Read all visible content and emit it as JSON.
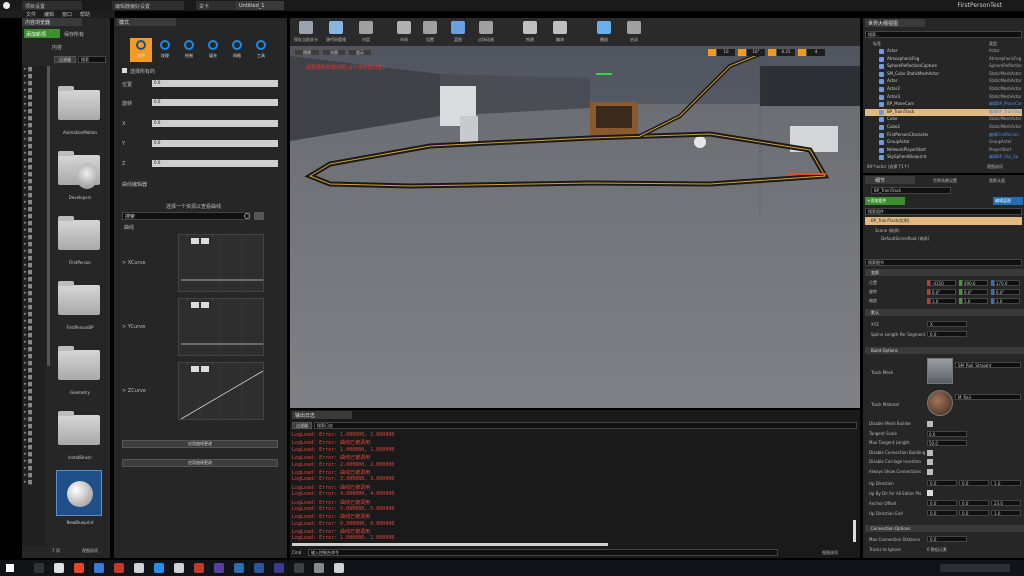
{
  "window": {
    "title": "FirstPersonTest",
    "tabs": [
      "项目设置",
      "编辑器偏好设置",
      "关卡",
      "Untitled_1"
    ],
    "menu": [
      "文件",
      "编辑",
      "窗口",
      "帮助"
    ]
  },
  "content_browser": {
    "tab": "内容浏览器",
    "add_button": "添加新项",
    "import_button": "导入",
    "save_button": "保存所有",
    "nav": [
      "内容"
    ],
    "filter_button": "过滤器",
    "search_placeholder": "搜索",
    "items": [
      {
        "label": "AnimationMotion",
        "type": "folder"
      },
      {
        "label": "Developers",
        "type": "folder-dev"
      },
      {
        "label": "FirstPerson",
        "type": "folder"
      },
      {
        "label": "FirstPersonBP",
        "type": "folder"
      },
      {
        "label": "Geometry",
        "type": "folder"
      },
      {
        "label": "InstallBrush",
        "type": "folder"
      },
      {
        "label": "NewBlueprint",
        "type": "sphere"
      }
    ],
    "footer_count": "7 项",
    "footer_view": "视图选项"
  },
  "modes": {
    "tab": "模式",
    "tools": [
      "选择",
      "纹理",
      "绘制",
      "填充",
      "网格",
      "工具"
    ],
    "section_title": "选择模式",
    "label_a": "选择所有的",
    "fields": [
      {
        "label": "位置",
        "value": "0.0"
      },
      {
        "label": "旋转",
        "value": "0.0"
      },
      {
        "label": "X",
        "value": "0.0"
      },
      {
        "label": "Y",
        "value": "0.0"
      },
      {
        "label": "Z",
        "value": "0.0"
      }
    ],
    "curve_title": "曲线编辑器",
    "hint": "选择一个资源以查看曲线",
    "search_placeholder": "搜索",
    "tree_label": "曲线",
    "curves": [
      {
        "label": "XCurve",
        "type": "flat"
      },
      {
        "label": "YCurve",
        "type": "flat"
      },
      {
        "label": "ZCurve",
        "type": "linear"
      }
    ],
    "button_a": "应用曲线更改",
    "button_b": "应用曲线更改"
  },
  "toolbar": {
    "buttons": [
      "保存当前关卡",
      "源代码管理",
      "内容",
      "市场",
      "设置",
      "蓝图",
      "过场动画",
      "构建",
      "编译",
      "播放",
      "启动"
    ]
  },
  "viewport": {
    "mode_a": "透视",
    "mode_b": "光照",
    "mode_c": "显示",
    "warning": "需要重新构建光照 (1个未构建对象)",
    "snap_values": [
      "10",
      "10°",
      "0.25",
      "4"
    ]
  },
  "output_log": {
    "tab": "输出日志",
    "filter": "过滤器",
    "search_placeholder": "搜索日志",
    "lines": [
      "LogLoad: Error: 1.000000, 1.000000",
      "LogLoad: Error: 曲线已被调用",
      "LogLoad: Error: 1.000000, 1.000000",
      "LogLoad: Error: 曲线已被调用",
      "LogLoad: Error: 2.000000, 2.000000",
      "LogLoad: Error: 曲线已被调用",
      "LogLoad: Error: 3.000000, 3.000000",
      "LogLoad: Error: 曲线已被调用",
      "LogLoad: Error: 4.000000, 4.000000",
      "LogLoad: Error: 曲线已被调用",
      "LogLoad: Error: 5.000000, 5.000000",
      "LogLoad: Error: 曲线已被调用",
      "LogLoad: Error: 0.000000, 0.000000",
      "LogLoad: Error: 曲线已被调用",
      "LogLoad: Error: 1.000000, 1.000000",
      "LogLoad: Error: 曲线已被调用",
      "LogLoad: Error: 2.000000, 2.000000",
      "LogLoad: Error: 曲线已被调用"
    ],
    "cmd_label": "Cmd",
    "cmd_placeholder": "输入控制台命令",
    "view_options": "视图选项"
  },
  "outliner": {
    "tab": "世界大纲视图",
    "search_placeholder": "搜索...",
    "col_label": "标签",
    "col_type": "类型",
    "rows": [
      {
        "label": "Actor",
        "type": "Actor"
      },
      {
        "label": "AtmosphericFog",
        "type": "AtmosphericFog"
      },
      {
        "label": "SphereReflectionCapture",
        "type": "SphereReflectionCapture"
      },
      {
        "label": "SM_Cube StaticMeshActor",
        "type": "StaticMeshActor"
      },
      {
        "label": "Actor",
        "type": "StaticMeshActor"
      },
      {
        "label": "Actor2",
        "type": "StaticMeshActor"
      },
      {
        "label": "Actor3",
        "type": "StaticMeshActor"
      },
      {
        "label": "BP_MoveCam",
        "type": "编辑BP_MoveCam"
      },
      {
        "label": "BP_TrainTrack",
        "type": "编辑BP_TrainTrack",
        "selected": true
      },
      {
        "label": "Cube",
        "type": "StaticMeshActor"
      },
      {
        "label": "Cube2",
        "type": "StaticMeshActor"
      },
      {
        "label": "FirstPersonCharacter",
        "type": "编辑FirstPerson"
      },
      {
        "label": "GroupActor",
        "type": "GroupActor"
      },
      {
        "label": "NetworkPlayerStart",
        "type": "PlayerStart"
      },
      {
        "label": "SkySphereBlueprint",
        "type": "编辑BP_Sky_Sp"
      }
    ],
    "footer": "69个actor (选择了1个)",
    "view_options": "视图选项"
  },
  "details": {
    "tabs": [
      "细节",
      "世界场景设置",
      "类默认值"
    ],
    "name": "BP_TrainTrack",
    "add_component": "+添加组件",
    "blueprint_button": "编辑蓝图",
    "search_placeholder": "搜索组件",
    "component_root": "BP_TrainTrack(实例)",
    "components": [
      "Scene (继承)",
      "DefaultSceneRoot (继承)"
    ],
    "search2_placeholder": "搜索细节",
    "transform_header": "变换",
    "transform": [
      {
        "label": "位置",
        "x": "-4150",
        "y": "490.0",
        "z": "170.0"
      },
      {
        "label": "旋转",
        "x": "0.0°",
        "y": "0.0°",
        "z": "0.0°"
      },
      {
        "label": "缩放",
        "x": "1.0",
        "y": "1.0",
        "z": "1.0"
      }
    ],
    "default_header": "默认",
    "xyz_label": "XYZ",
    "xyz_value": "X",
    "spline_label": "Spline Length Per Segment",
    "spline_value": "0.0",
    "build_header": "Build Options",
    "track_mesh_label": "Track Mesh",
    "track_mesh_value": "SM_Rail_Straight",
    "track_material_label": "Track Material",
    "track_material_value": "M_Rail",
    "options": [
      {
        "label": "Disable Mesh Builder",
        "kind": "check"
      },
      {
        "label": "Tangent Scale",
        "kind": "num",
        "value": "0.0"
      },
      {
        "label": "Max Tangent Length",
        "kind": "num",
        "value": "50.0"
      },
      {
        "label": "Disable Connection Building",
        "kind": "check"
      },
      {
        "label": "Disable Carriage Insertion",
        "kind": "check"
      },
      {
        "label": "Always Show Connections",
        "kind": "check"
      }
    ],
    "up_direction_label": "Up Direction",
    "up_direction": {
      "x": "0.0",
      "y": "0.0",
      "z": "1.0"
    },
    "up_by_label": "Up By Dir for All Editor Pts",
    "anchor_label": "Anchor Offset",
    "anchor": {
      "x": "0.0",
      "y": "0.0",
      "z": "23.0"
    },
    "up_end_label": "Up Direction End",
    "up_end": {
      "x": "0.0",
      "y": "0.0",
      "z": "1.0"
    },
    "conn_header": "Connection Options",
    "max_conn_label": "Max Connection Distance",
    "max_conn_value": "0.0",
    "tracks_label": "Tracks to Ignore",
    "tracks_value": "0 数组元素"
  }
}
